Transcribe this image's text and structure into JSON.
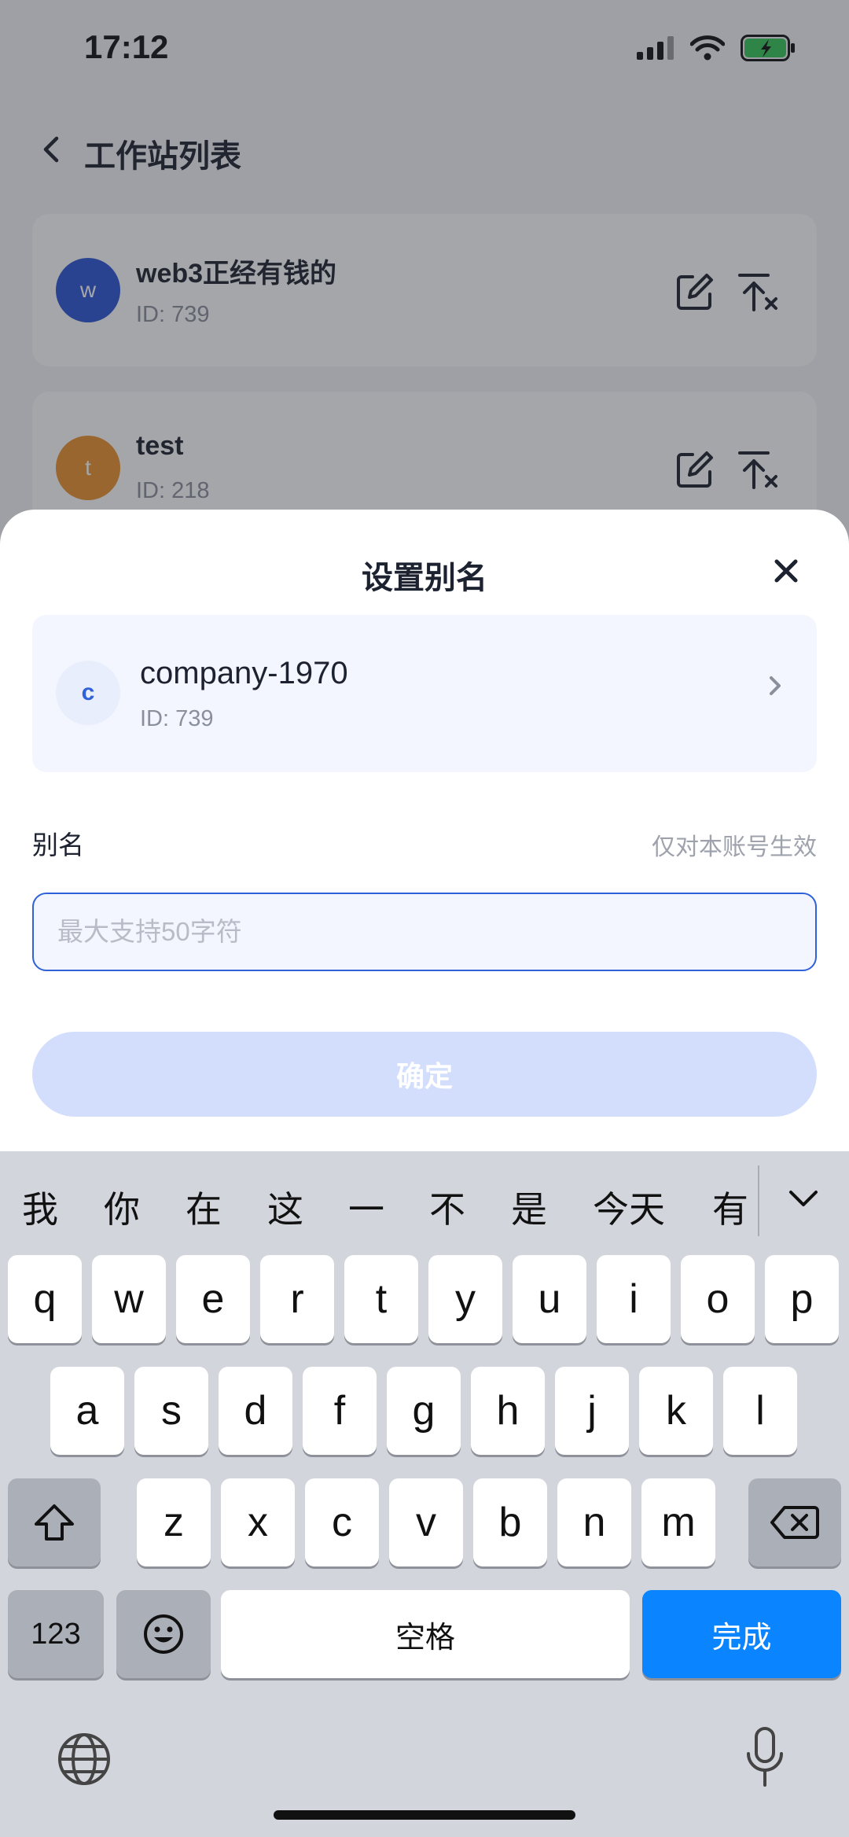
{
  "status": {
    "time": "17:12"
  },
  "nav": {
    "title": "工作站列表"
  },
  "workstations": [
    {
      "avatar_letter": "w",
      "avatar_color": "#2a55d6",
      "name": "web3正经有钱的",
      "id": "ID: 739"
    },
    {
      "avatar_letter": "t",
      "avatar_color": "#e8912b",
      "name": "test",
      "id": "ID: 218"
    }
  ],
  "sheet": {
    "title": "设置别名",
    "selected": {
      "avatar_letter": "c",
      "name": "company-1970",
      "id": "ID: 739"
    },
    "alias_label": "别名",
    "alias_hint": "仅对本账号生效",
    "alias_value": "",
    "alias_placeholder": "最大支持50字符",
    "confirm_label": "确定"
  },
  "keyboard": {
    "candidates": [
      "我",
      "你",
      "在",
      "这",
      "一",
      "不",
      "是",
      "今天",
      "有"
    ],
    "row1": [
      "q",
      "w",
      "e",
      "r",
      "t",
      "y",
      "u",
      "i",
      "o",
      "p"
    ],
    "row2": [
      "a",
      "s",
      "d",
      "f",
      "g",
      "h",
      "j",
      "k",
      "l"
    ],
    "row3": [
      "z",
      "x",
      "c",
      "v",
      "b",
      "n",
      "m"
    ],
    "numbers_label": "123",
    "space_label": "空格",
    "done_label": "完成"
  },
  "colors": {
    "accent": "#2f62d8",
    "done_key": "#0a84ff",
    "battery": "#34c759"
  }
}
